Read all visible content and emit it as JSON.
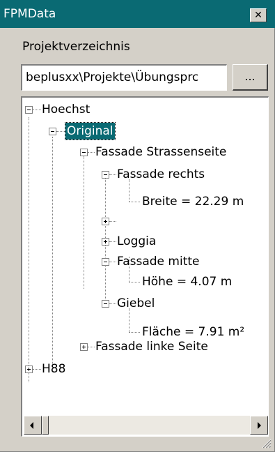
{
  "window": {
    "title": "FPMData",
    "close_label": "✕"
  },
  "project": {
    "label": "Projektverzeichnis",
    "path": "beplusxx\\Projekte\\Übungsprc",
    "browse_label": "..."
  },
  "tree": {
    "nodes": [
      {
        "label": "Hoechst",
        "expanded": true
      },
      {
        "label": "Original",
        "expanded": true,
        "selected": true
      },
      {
        "label": "Fassade Strassenseite",
        "expanded": true
      },
      {
        "label": "Fassade rechts",
        "expanded": true
      },
      {
        "label": "Breite = 22.29 m"
      },
      {
        "label": "",
        "expanded": false
      },
      {
        "label": "Loggia",
        "expanded": false
      },
      {
        "label": "Fassade mitte",
        "expanded": true
      },
      {
        "label": "Höhe = 4.07 m"
      },
      {
        "label": "Giebel",
        "expanded": true
      },
      {
        "label": "Fläche = 7.91 m²"
      },
      {
        "label": "Fassade linke Seite",
        "expanded": false
      },
      {
        "label": "H88",
        "expanded": false
      }
    ]
  },
  "icons": {
    "close": "close-icon",
    "scroll_left": "scroll-left-icon",
    "scroll_right": "scroll-right-icon",
    "resize_grip": "resize-grip-icon"
  }
}
